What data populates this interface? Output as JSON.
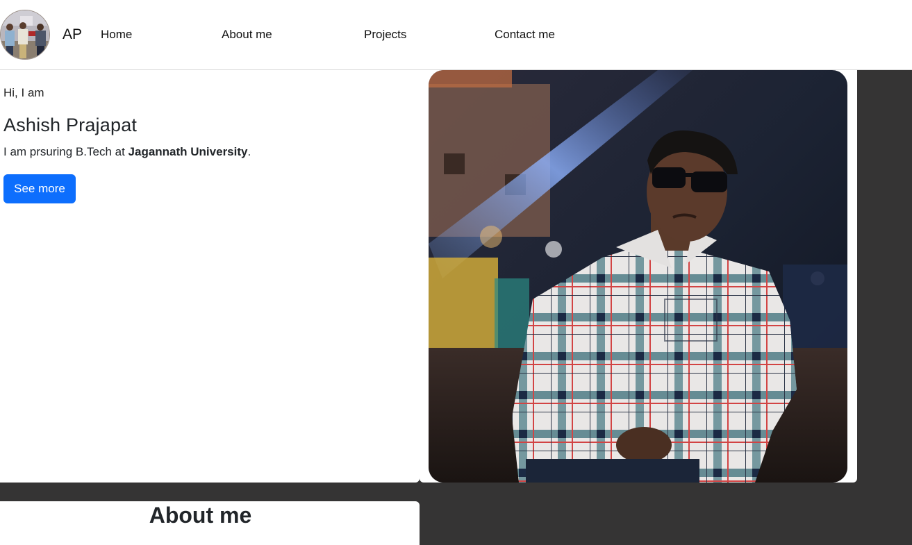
{
  "navbar": {
    "brand": "AP",
    "links": [
      "Home",
      "About me",
      "Projects",
      "Contact me"
    ]
  },
  "hero": {
    "greeting": "Hi, I am",
    "name": "Ashish Prajapat",
    "subtitle_prefix": "I am prsuring B.Tech at ",
    "university": "Jagannath University",
    "subtitle_suffix": ".",
    "button_label": "See more"
  },
  "about": {
    "title": "About me"
  },
  "colors": {
    "page_background": "#353434",
    "primary_button": "#0d6efd",
    "card_background": "#ffffff"
  }
}
